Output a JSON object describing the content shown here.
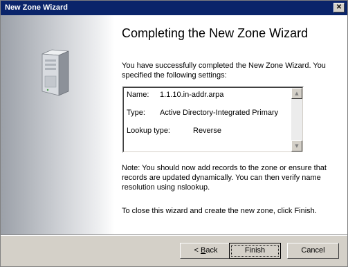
{
  "window": {
    "title": "New Zone Wizard",
    "close_glyph": "✕"
  },
  "page": {
    "title": "Completing the New Zone Wizard",
    "intro": "You have successfully completed the New Zone Wizard. You specified the following settings:"
  },
  "settings": [
    {
      "label": "Name:",
      "value": "1.1.10.in-addr.arpa"
    },
    {
      "label": "Type:",
      "value": "Active Directory-Integrated Primary"
    },
    {
      "label": "Lookup type:",
      "value": "Reverse"
    }
  ],
  "scrollbar": {
    "up_glyph": "▲",
    "down_glyph": "▼"
  },
  "note": "Note: You should now add records to the zone or ensure that records are updated dynamically. You can then verify name resolution using nslookup.",
  "closing": "To close this wizard and create the new zone, click Finish.",
  "buttons": {
    "back_prefix": "< ",
    "back_mnemonic": "B",
    "back_rest": "ack",
    "finish": "Finish",
    "cancel": "Cancel"
  },
  "icons": {
    "server": "server-tower-icon",
    "close": "close-icon"
  }
}
